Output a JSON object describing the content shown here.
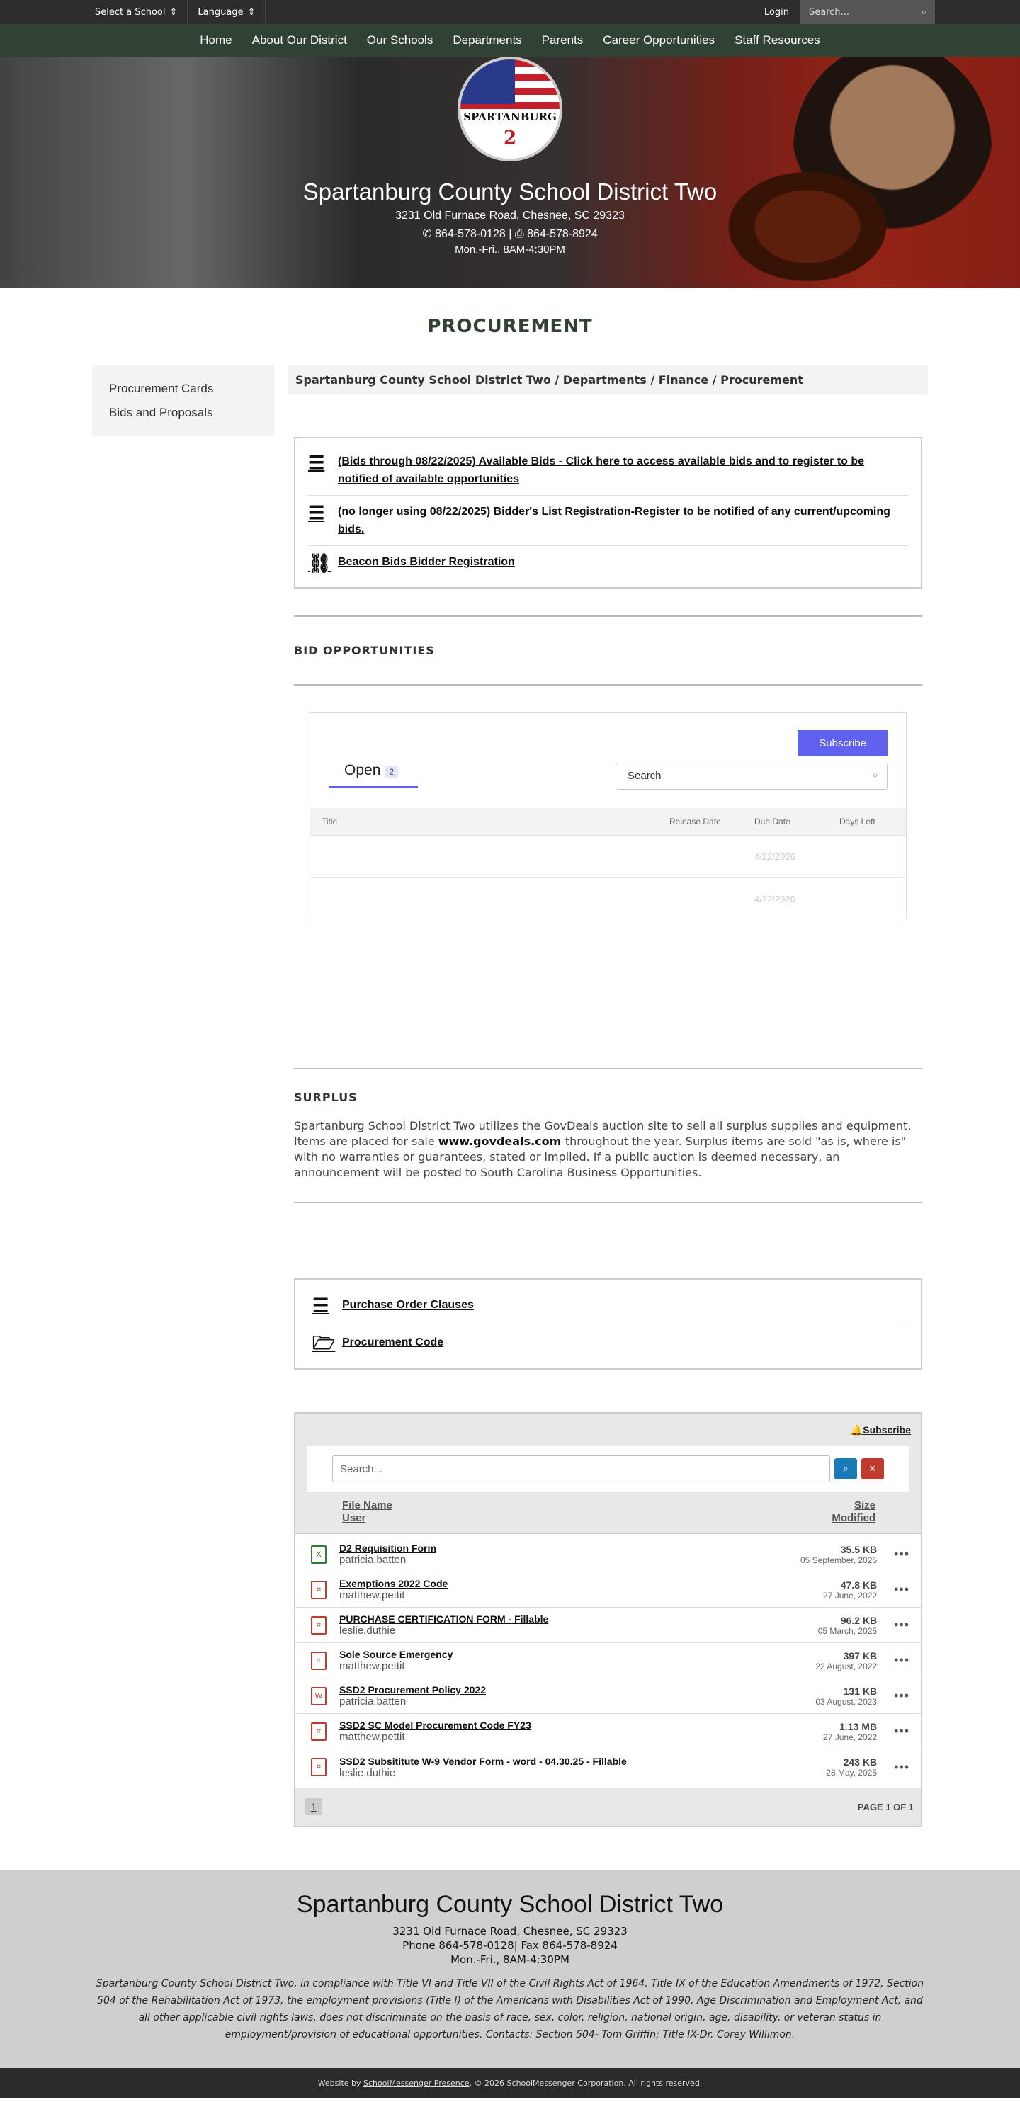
{
  "topbar": {
    "select_school": "Select a School",
    "language": "Language",
    "login": "Login",
    "search_placeholder": "Search..."
  },
  "nav": [
    "Home",
    "About Our District",
    "Our Schools",
    "Departments",
    "Parents",
    "Career Opportunities",
    "Staff Resources"
  ],
  "hero": {
    "logo_word": "SPARTANBURG",
    "logo_num": "2",
    "name": "Spartanburg County School District Two",
    "address": "3231 Old Furnace Road, Chesnee, SC 29323",
    "phone": "864-578-0128",
    "fax": "864-578-8924",
    "hours": "Mon.-Fri., 8AM-4:30PM"
  },
  "page_title": "PROCUREMENT",
  "sidebar": [
    "Procurement Cards",
    "Bids and Proposals"
  ],
  "breadcrumb": {
    "path": "Spartanburg County School District Two / Departments / Finance / ",
    "current": "Procurement"
  },
  "links": [
    {
      "icon": "list-icon",
      "text": "(Bids through 08/22/2025) Available Bids - Click here to access available bids and to register to be notified of available opportunities"
    },
    {
      "icon": "list-icon",
      "text": "(no longer using 08/22/2025) Bidder's List Registration-Register to be notified of any current/upcoming bids."
    },
    {
      "icon": "link-icon",
      "text": "Beacon Bids Bidder Registration"
    }
  ],
  "bids": {
    "heading": "BID OPPORTUNITIES",
    "subscribe": "Subscribe",
    "tab": "Open",
    "count": "2",
    "search": "Search",
    "columns": [
      "Title",
      "Release Date",
      "Due Date",
      "Days Left"
    ],
    "rows": [
      {
        "due": "4/22/2026"
      },
      {
        "due": "4/22/2026"
      }
    ]
  },
  "surplus": {
    "heading": "SURPLUS",
    "text1": "Spartanburg School District Two utilizes the GovDeals auction site to sell all surplus supplies and equipment. Items are placed for sale ",
    "link": "www.govdeals.com ",
    "text2": "throughout the year. Surplus items are sold \"as is, where is\" with no warranties or guarantees, stated or implied. If a public auction is deemed necessary, an announcement will be posted to South Carolina Business Opportunities."
  },
  "docs": [
    {
      "icon": "align-icon",
      "text": "Purchase Order Clauses"
    },
    {
      "icon": "folder-open-icon",
      "text": "Procurement Code"
    }
  ],
  "files": {
    "subscribe": "Subscribe",
    "search_placeholder": "Search...",
    "col_name": "File Name",
    "col_user": "User",
    "col_size": "Size",
    "col_modified": "Modified",
    "items": [
      {
        "type": "xls",
        "name": "D2 Requisition Form",
        "user": "patricia.batten",
        "size": "35.5 KB",
        "date": "05 September, 2025"
      },
      {
        "type": "pdf",
        "name": "Exemptions 2022 Code",
        "user": "matthew.pettit",
        "size": "47.8 KB",
        "date": "27 June, 2022"
      },
      {
        "type": "pdf",
        "name": "PURCHASE CERTIFICATION FORM - Fillable",
        "user": "leslie.duthie",
        "size": "96.2 KB",
        "date": "05 March, 2025"
      },
      {
        "type": "pdf",
        "name": "Sole Source Emergency",
        "user": "matthew.pettit",
        "size": "397 KB",
        "date": "22 August, 2022"
      },
      {
        "type": "doc",
        "name": "SSD2 Procurement Policy 2022",
        "user": "patricia.batten",
        "size": "131 KB",
        "date": "03 August, 2023"
      },
      {
        "type": "pdf",
        "name": "SSD2 SC Model Procurement Code FY23",
        "user": "matthew.pettit",
        "size": "1.13 MB",
        "date": "27 June, 2022"
      },
      {
        "type": "pdf",
        "name": "SSD2 Subsititute W-9 Vendor Form - word - 04.30.25 - Fillable",
        "user": "leslie.duthie",
        "size": "243 KB",
        "date": "28 May, 2025"
      }
    ],
    "page": "1",
    "page_of": "PAGE 1 OF 1"
  },
  "footer": {
    "name": "Spartanburg County School District Two",
    "address": "3231 Old Furnace Road, Chesnee, SC 29323",
    "phone": "Phone 864-578-0128| Fax 864-578-8924",
    "hours": "Mon.-Fri., 8AM-4:30PM",
    "legal": "Spartanburg County School District Two, in compliance with Title VI and Title VII of the Civil Rights Act of 1964, Title IX of the Education Amendments of 1972, Section 504 of the Rehabilitation Act of 1973, the employment provisions (Title I) of the Americans with Disabilities Act of 1990, Age Discrimination and Employment Act, and all other applicable civil rights laws, does not discriminate on the basis of race, sex, color, religion, national origin, age, disability, or veteran status in employment/provision of educational opportunities. Contacts: Section 504- Tom Griffin; Title IX-Dr. Corey Willimon.",
    "credit_pre": "Website by ",
    "credit_link": "SchoolMessenger Presence",
    "credit_post": ". © 2026 SchoolMessenger Corporation. All rights reserved."
  }
}
